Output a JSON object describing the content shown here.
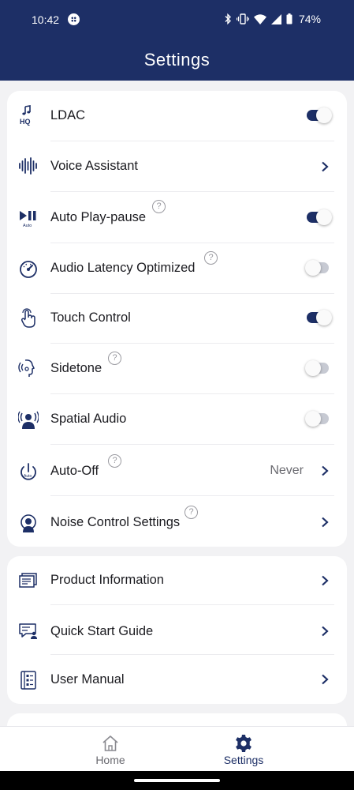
{
  "status_bar": {
    "time": "10:42",
    "battery": "74%"
  },
  "header": {
    "title": "Settings"
  },
  "settings": [
    {
      "label": "LDAC",
      "control": "toggle",
      "on": true,
      "icon": "ldac-hq-icon"
    },
    {
      "label": "Voice Assistant",
      "control": "chevron",
      "icon": "voice-waveform-icon"
    },
    {
      "label": "Auto Play-pause",
      "control": "toggle",
      "on": true,
      "help": true,
      "icon": "auto-play-pause-icon"
    },
    {
      "label": "Audio Latency Optimized",
      "control": "toggle",
      "on": false,
      "help": true,
      "icon": "latency-gauge-icon"
    },
    {
      "label": "Touch Control",
      "control": "toggle",
      "on": true,
      "icon": "touch-finger-icon"
    },
    {
      "label": "Sidetone",
      "control": "toggle",
      "on": false,
      "help": true,
      "icon": "sidetone-face-icon"
    },
    {
      "label": "Spatial Audio",
      "control": "toggle",
      "on": false,
      "icon": "spatial-audio-icon"
    },
    {
      "label": "Auto-Off",
      "control": "chevron",
      "value": "Never",
      "help": true,
      "icon": "auto-off-power-icon"
    },
    {
      "label": "Noise Control Settings",
      "control": "chevron",
      "help": true,
      "icon": "noise-control-icon"
    }
  ],
  "info": [
    {
      "label": "Product Information",
      "icon": "product-info-icon"
    },
    {
      "label": "Quick Start Guide",
      "icon": "quick-start-guide-icon"
    },
    {
      "label": "User Manual",
      "icon": "user-manual-icon"
    }
  ],
  "bottom_nav": {
    "home": "Home",
    "settings": "Settings",
    "active": "settings"
  },
  "colors": {
    "header": "#1d2f66",
    "accent": "#1d2f66",
    "background": "#f2f2f4",
    "card": "#ffffff",
    "toggle_off": "#c7cad3"
  }
}
